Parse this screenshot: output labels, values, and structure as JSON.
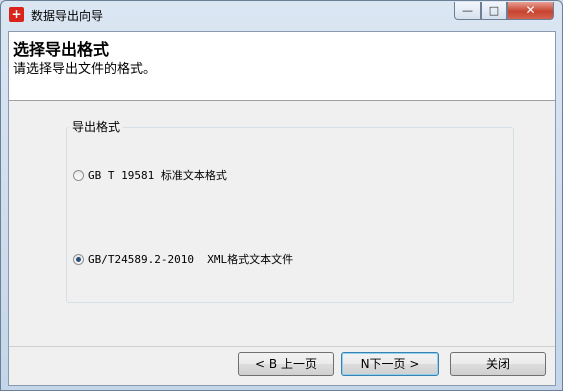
{
  "window": {
    "title": "数据导出向导",
    "controls": {
      "minimize": "—",
      "maximize": "□",
      "close": "✕"
    }
  },
  "header": {
    "title": "选择导出格式",
    "subtitle": "请选择导出文件的格式。"
  },
  "group": {
    "label": "导出格式",
    "options": [
      {
        "label": "GB T 19581 标准文本格式",
        "checked": false
      },
      {
        "label": "GB/T24589.2-2010  XML格式文本文件",
        "checked": true
      }
    ]
  },
  "buttons": {
    "back": "< B 上一页",
    "next": "N下一页 >",
    "close": "关闭"
  },
  "colors": {
    "accent": "#3c7fb1",
    "app_icon": "#d9241c"
  }
}
